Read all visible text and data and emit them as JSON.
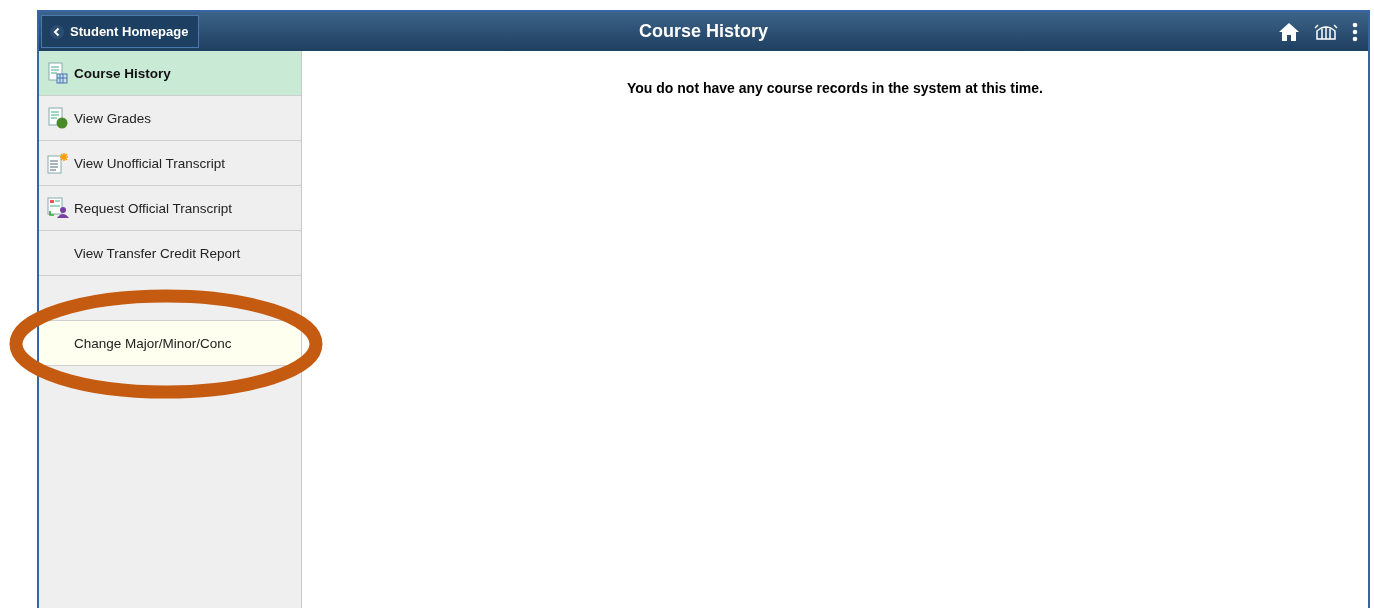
{
  "header": {
    "back_button": "Student Homepage",
    "title": "Course History"
  },
  "sidebar": {
    "items": [
      {
        "label": "Course History",
        "kind": "calendar-doc",
        "selected": true,
        "highlighted": false
      },
      {
        "label": "View Grades",
        "kind": "grade-doc",
        "selected": false,
        "highlighted": false
      },
      {
        "label": "View Unofficial Transcript",
        "kind": "star-doc",
        "selected": false,
        "highlighted": false
      },
      {
        "label": "Request Official Transcript",
        "kind": "person-doc",
        "selected": false,
        "highlighted": false
      },
      {
        "label": "View Transfer Credit Report",
        "selected": false,
        "highlighted": false
      },
      {
        "selected": false,
        "highlighted": false
      },
      {
        "label": "Change Major/Minor/Conc",
        "selected": false,
        "highlighted": true
      }
    ]
  },
  "message": "You do not have any course records in the system at this time.",
  "annotation": {
    "kind": "ellipse"
  }
}
